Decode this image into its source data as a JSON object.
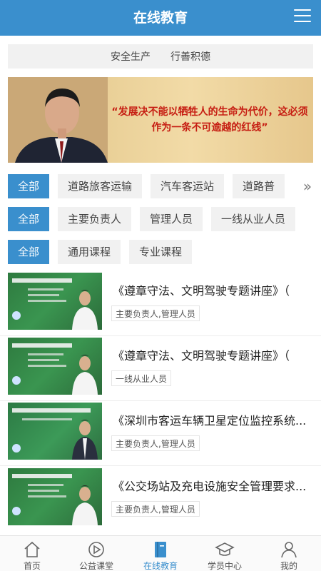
{
  "header": {
    "title": "在线教育"
  },
  "quick_links": [
    {
      "label": "安全生产"
    },
    {
      "label": "行善积德"
    }
  ],
  "banner": {
    "quote_line1": "“发展决不能以牺牲人的生命为代价，这必须",
    "quote_line2": "作为一条不可逾越的红线”"
  },
  "filters": {
    "row1": {
      "all": "全部",
      "items": [
        "道路旅客运输",
        "汽车客运站",
        "道路普"
      ]
    },
    "row2": {
      "all": "全部",
      "items": [
        "主要负责人",
        "管理人员",
        "一线从业人员"
      ]
    },
    "row3": {
      "all": "全部",
      "items": [
        "通用课程",
        "专业课程"
      ]
    }
  },
  "courses": [
    {
      "title": "《遵章守法、文明驾驶专题讲座》（",
      "tag": "主要负责人,管理人员"
    },
    {
      "title": "《遵章守法、文明驾驶专题讲座》（",
      "tag": "一线从业人员"
    },
    {
      "title": "《深圳市客运车辆卫星定位监控系统...",
      "tag": "主要负责人,管理人员"
    },
    {
      "title": "《公交场站及充电设施安全管理要求...",
      "tag": "主要负责人,管理人员"
    }
  ],
  "tabbar": {
    "items": [
      {
        "label": "首页",
        "icon": "home-icon"
      },
      {
        "label": "公益课堂",
        "icon": "play-icon"
      },
      {
        "label": "在线教育",
        "icon": "book-icon"
      },
      {
        "label": "学员中心",
        "icon": "graduation-cap-icon"
      },
      {
        "label": "我的",
        "icon": "person-icon"
      }
    ]
  },
  "colors": {
    "accent": "#3a8fcd",
    "quote_red": "#c61d12"
  }
}
